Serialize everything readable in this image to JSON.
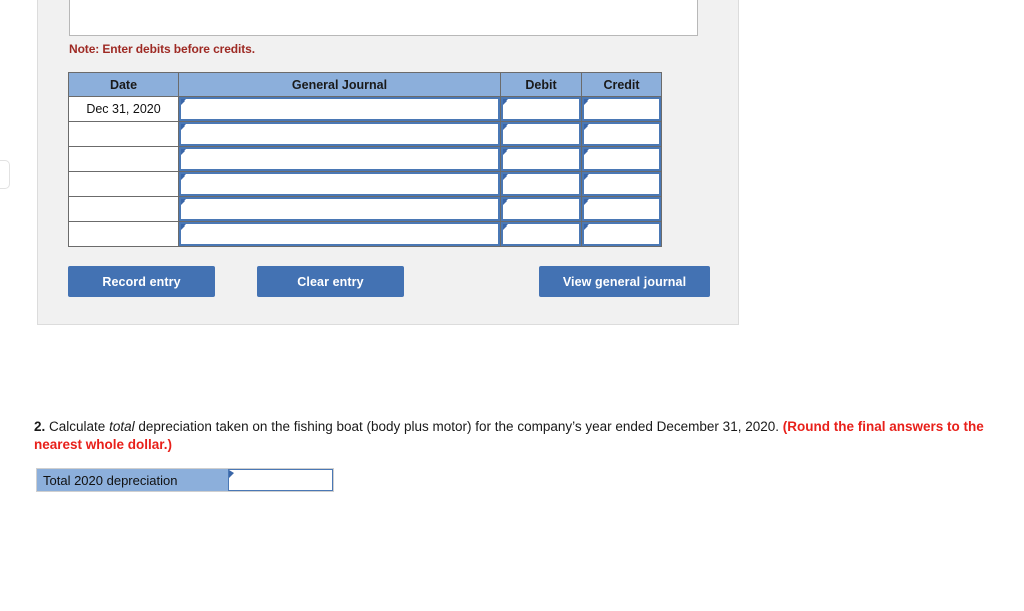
{
  "edge_tab": {
    "name": "collapsed-panel-tab"
  },
  "journal_form": {
    "memo_placeholder": "",
    "note": "Note: Enter debits before credits.",
    "table": {
      "headers": [
        "Date",
        "General Journal",
        "Debit",
        "Credit"
      ],
      "rows": [
        {
          "date": "Dec 31, 2020",
          "general_journal": "",
          "debit": "",
          "credit": ""
        },
        {
          "date": "",
          "general_journal": "",
          "debit": "",
          "credit": ""
        },
        {
          "date": "",
          "general_journal": "",
          "debit": "",
          "credit": ""
        },
        {
          "date": "",
          "general_journal": "",
          "debit": "",
          "credit": ""
        },
        {
          "date": "",
          "general_journal": "",
          "debit": "",
          "credit": ""
        },
        {
          "date": "",
          "general_journal": "",
          "debit": "",
          "credit": ""
        }
      ]
    },
    "buttons": {
      "record": "Record entry",
      "clear": "Clear entry",
      "view": "View general journal"
    }
  },
  "question2": {
    "number": "2.",
    "text_before_italic": " Calculate ",
    "italic_word": "total",
    "text_after_italic": " depreciation taken on the fishing boat (body plus motor) for the company’s year ended December 31, 2020. ",
    "red_instruction": "(Round the final answers to the nearest whole dollar.)",
    "answer": {
      "label": "Total 2020 depreciation",
      "value": ""
    }
  },
  "colors": {
    "header_blue": "#8cafdb",
    "button_blue": "#4372b3",
    "note_red": "#9e2a24",
    "instruction_red": "#e8201a",
    "panel_gray": "#f1f1f1",
    "input_border_blue": "#4a78b5"
  }
}
